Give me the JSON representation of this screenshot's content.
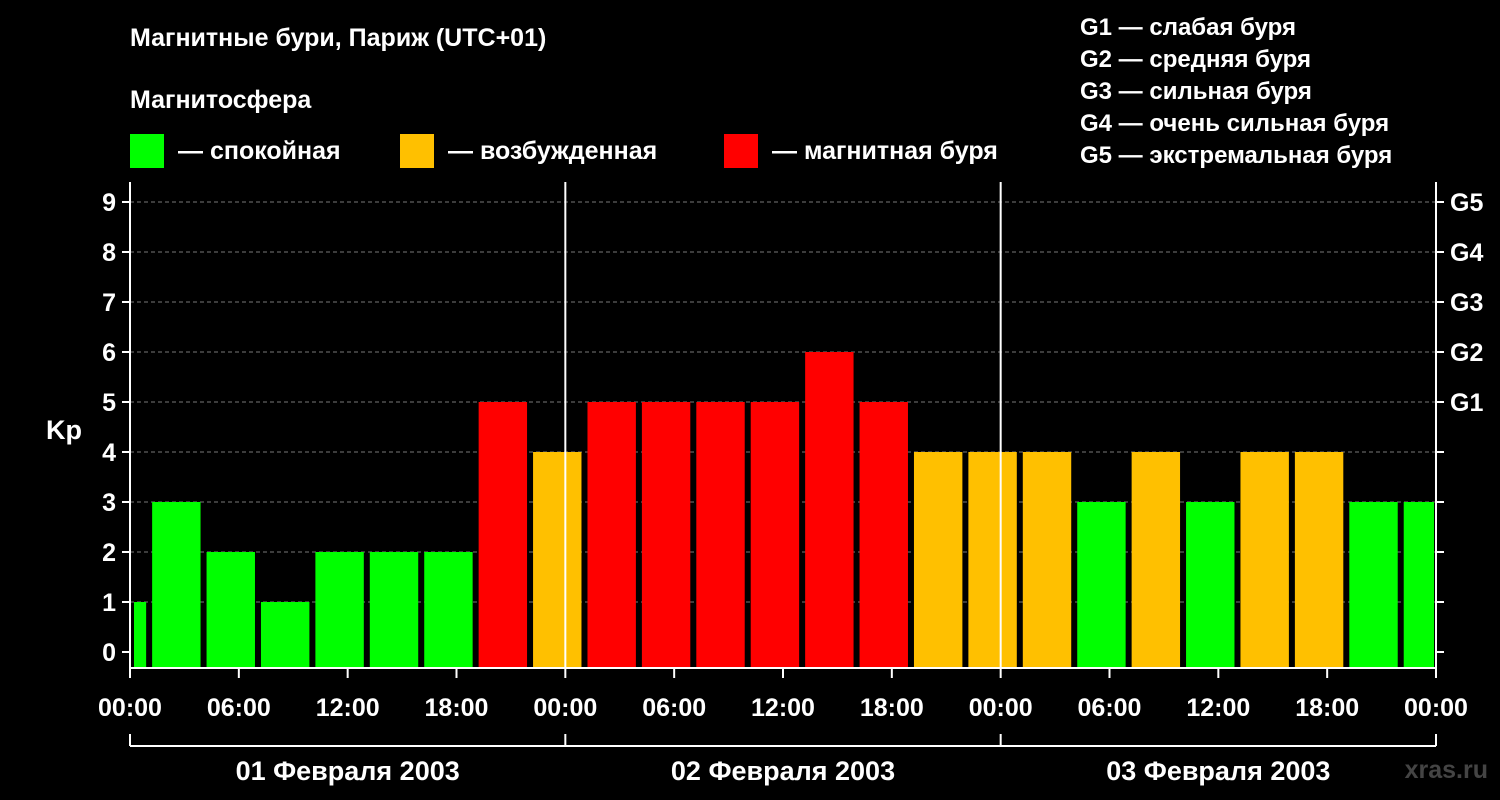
{
  "title": "Магнитные бури, Париж (UTC+01)",
  "subtitle": "Магнитосфера",
  "legend": [
    {
      "label": "— спокойная",
      "color": "#00ff00"
    },
    {
      "label": "— возбужденная",
      "color": "#ffc000"
    },
    {
      "label": "— магнитная буря",
      "color": "#ff0000"
    }
  ],
  "g_scale": [
    "G1 — слабая буря",
    "G2 — средняя буря",
    "G3 — сильная буря",
    "G4 — очень сильная буря",
    "G5 — экстремальная буря"
  ],
  "watermark": "xras.ru",
  "chart_data": {
    "type": "bar",
    "ylabel": "Kp",
    "ylim": [
      0,
      9
    ],
    "yticks": [
      "0",
      "1",
      "2",
      "3",
      "4",
      "5",
      "6",
      "7",
      "8",
      "9"
    ],
    "right_ticks": [
      {
        "value": 5,
        "label": "G1"
      },
      {
        "value": 6,
        "label": "G2"
      },
      {
        "value": 7,
        "label": "G3"
      },
      {
        "value": 8,
        "label": "G4"
      },
      {
        "value": 9,
        "label": "G5"
      }
    ],
    "grid": true,
    "xtick_labels": [
      "00:00",
      "06:00",
      "12:00",
      "18:00",
      "00:00",
      "06:00",
      "12:00",
      "18:00",
      "00:00",
      "06:00",
      "12:00",
      "18:00",
      "00:00"
    ],
    "days": [
      "01 Февраля 2003",
      "02 Февраля 2003",
      "03 Февраля 2003"
    ],
    "x_unit": "hours",
    "x_range": [
      0,
      72
    ],
    "bars": [
      {
        "start": 0,
        "end": 1,
        "kp": 1,
        "state": "quiet"
      },
      {
        "start": 1,
        "end": 4,
        "kp": 3,
        "state": "quiet"
      },
      {
        "start": 4,
        "end": 7,
        "kp": 2,
        "state": "quiet"
      },
      {
        "start": 7,
        "end": 10,
        "kp": 1,
        "state": "quiet"
      },
      {
        "start": 10,
        "end": 13,
        "kp": 2,
        "state": "quiet"
      },
      {
        "start": 13,
        "end": 16,
        "kp": 2,
        "state": "quiet"
      },
      {
        "start": 16,
        "end": 19,
        "kp": 2,
        "state": "quiet"
      },
      {
        "start": 19,
        "end": 22,
        "kp": 5,
        "state": "storm"
      },
      {
        "start": 22,
        "end": 25,
        "kp": 4,
        "state": "active"
      },
      {
        "start": 25,
        "end": 28,
        "kp": 5,
        "state": "storm"
      },
      {
        "start": 28,
        "end": 31,
        "kp": 5,
        "state": "storm"
      },
      {
        "start": 31,
        "end": 34,
        "kp": 5,
        "state": "storm"
      },
      {
        "start": 34,
        "end": 37,
        "kp": 5,
        "state": "storm"
      },
      {
        "start": 37,
        "end": 40,
        "kp": 6,
        "state": "storm"
      },
      {
        "start": 40,
        "end": 43,
        "kp": 5,
        "state": "storm"
      },
      {
        "start": 43,
        "end": 46,
        "kp": 4,
        "state": "active"
      },
      {
        "start": 46,
        "end": 49,
        "kp": 4,
        "state": "active"
      },
      {
        "start": 49,
        "end": 52,
        "kp": 4,
        "state": "active"
      },
      {
        "start": 52,
        "end": 55,
        "kp": 3,
        "state": "quiet"
      },
      {
        "start": 55,
        "end": 58,
        "kp": 4,
        "state": "active"
      },
      {
        "start": 58,
        "end": 61,
        "kp": 3,
        "state": "quiet"
      },
      {
        "start": 61,
        "end": 64,
        "kp": 4,
        "state": "active"
      },
      {
        "start": 64,
        "end": 67,
        "kp": 4,
        "state": "active"
      },
      {
        "start": 67,
        "end": 70,
        "kp": 3,
        "state": "quiet"
      },
      {
        "start": 70,
        "end": 72,
        "kp": 3,
        "state": "quiet"
      }
    ],
    "state_colors": {
      "quiet": "#00ff00",
      "active": "#ffc000",
      "storm": "#ff0000"
    }
  }
}
